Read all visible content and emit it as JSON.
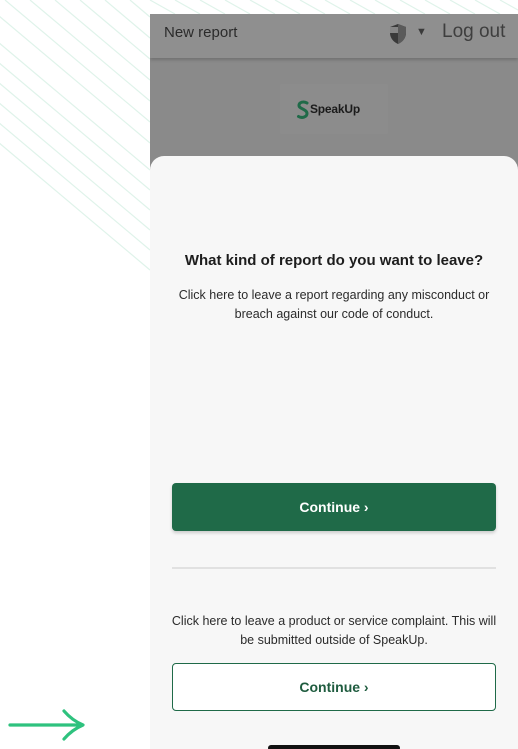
{
  "colors": {
    "brand_green": "#1f6a48",
    "accent_teal": "#2ec27e",
    "overlay_gray": "#8a8a8a",
    "sheet_bg": "#f7f7f7"
  },
  "header": {
    "title": "New report",
    "security_icon": "shield-icon",
    "dropdown_icon": "caret-down-icon",
    "logout_label": "Log out"
  },
  "brand": {
    "logo_text": "SpeakUp"
  },
  "sheet": {
    "question": "What kind of report do you want to leave?",
    "option_misconduct": {
      "description": "Click here to leave a report regarding any misconduct or breach against our code of conduct.",
      "button_label": "Continue ›"
    },
    "option_complaint": {
      "description": "Click here to leave a product or service complaint. This will be submitted outside of SpeakUp.",
      "button_label": "Continue ›"
    }
  },
  "decorations": {
    "pointer_icon": "arrow-right-icon"
  }
}
